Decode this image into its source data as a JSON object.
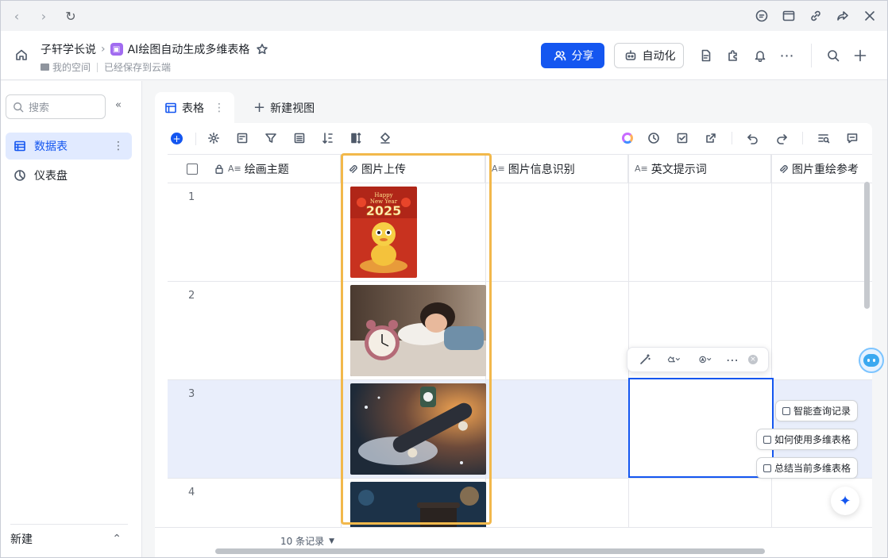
{
  "browser": {
    "icons": [
      "back-icon",
      "forward-icon",
      "refresh-icon",
      "comment-icon",
      "window-icon",
      "link-icon",
      "share-arrow-icon",
      "close-icon"
    ]
  },
  "header": {
    "workspace": "子轩学长说",
    "doc_title": "AI绘图自动生成多维表格",
    "folder": "我的空间",
    "save_status": "已经保存到云端",
    "share_label": "分享",
    "automation_label": "自动化"
  },
  "sidebar": {
    "search_placeholder": "搜索",
    "items": [
      {
        "label": "数据表"
      },
      {
        "label": "仪表盘"
      }
    ],
    "new_label": "新建"
  },
  "tabs": {
    "active": "表格",
    "new_view": "新建视图"
  },
  "columns": [
    {
      "label": "绘画主题"
    },
    {
      "label": "图片上传"
    },
    {
      "label": "图片信息识别"
    },
    {
      "label": "英文提示词"
    },
    {
      "label": "图片重绘参考"
    }
  ],
  "rows": [
    {
      "num": "1",
      "image_alt": "2025 Happy New Year snake"
    },
    {
      "num": "2",
      "image_alt": "girl sleeping with alarm clock"
    },
    {
      "num": "3",
      "image_alt": "skateboard splash"
    },
    {
      "num": "4",
      "image_alt": "coffee cup"
    }
  ],
  "image_badge": {
    "line1": "Happy",
    "line2": "New Year",
    "year": "2025"
  },
  "ai_pills": [
    {
      "label": "智能查询记录"
    },
    {
      "label": "如何使用多维表格"
    },
    {
      "label": "总结当前多维表格"
    }
  ],
  "footer": {
    "records": "10 条记录"
  },
  "colors": {
    "accent": "#1456f0",
    "highlight": "#f2b84b",
    "selected_row": "#e9eefb"
  }
}
